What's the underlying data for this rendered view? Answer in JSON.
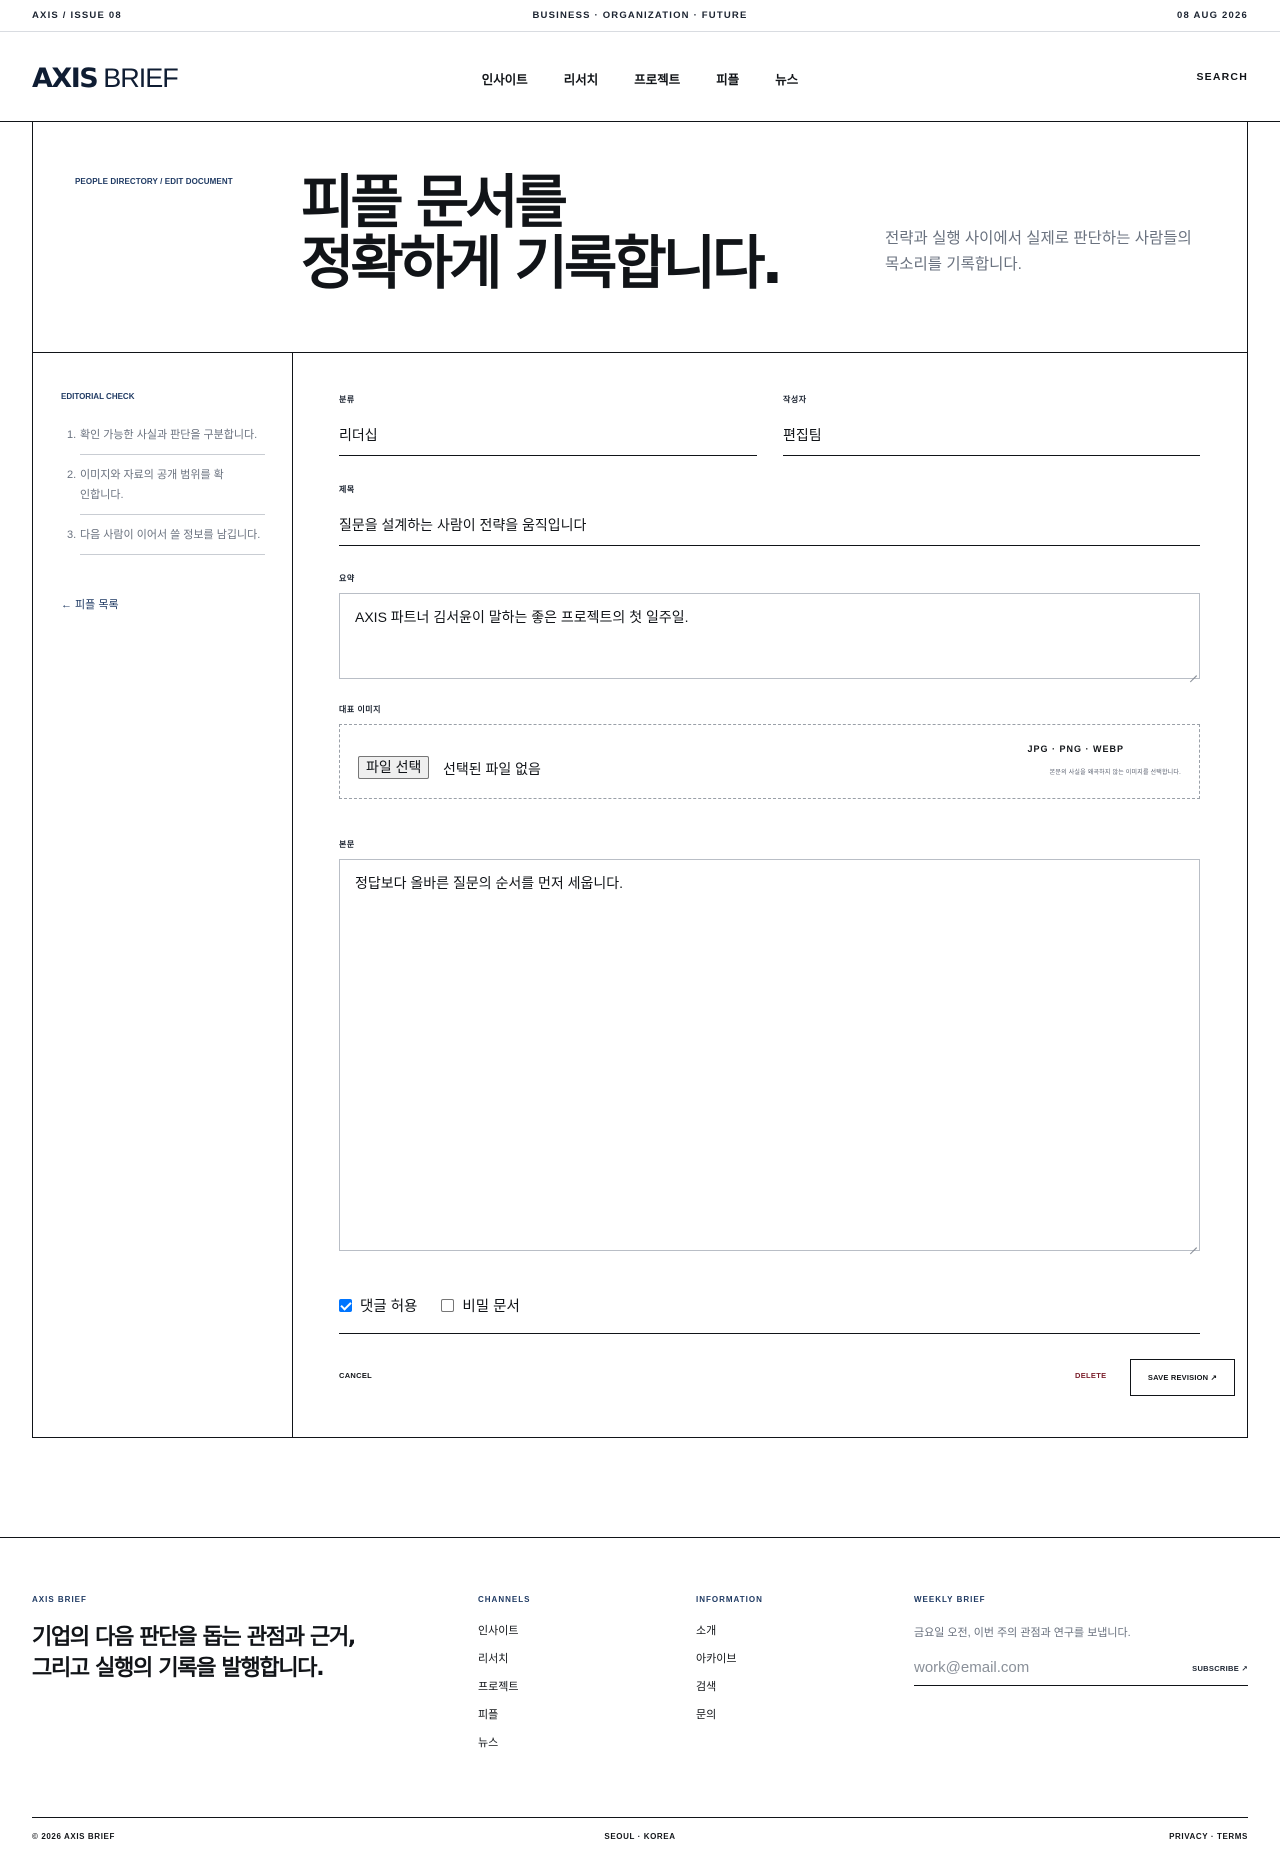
{
  "topbar": {
    "left": "AXIS / ISSUE 08",
    "center": "BUSINESS · ORGANIZATION · FUTURE",
    "right": "08 AUG 2026"
  },
  "header": {
    "logo_bold": "AXIS",
    "logo_light": "BRIEF",
    "nav": [
      "인사이트",
      "리서치",
      "프로젝트",
      "피플",
      "뉴스"
    ],
    "search": "SEARCH"
  },
  "hero": {
    "breadcrumb": "PEOPLE DIRECTORY / EDIT DOCUMENT",
    "title_line1": "피플 문서를",
    "title_line2": "정확하게 기록합니다.",
    "description": "전략과 실행 사이에서 실제로 판단하는 사람들의 목소리를 기록합니다."
  },
  "sidebar": {
    "label": "EDITORIAL CHECK",
    "checks": [
      {
        "num": "1.",
        "text": "확인 가능한 사실과 판단을 구분합니다."
      },
      {
        "num": "2.",
        "text": "이미지와 자료의 공개 범위를 확인합니다."
      },
      {
        "num": "3.",
        "text": "다음 사람이 이어서 쓸 정보를 남깁니다."
      }
    ],
    "back_link": "← 피플 목록"
  },
  "form": {
    "category_label": "분류",
    "category_value": "리더십",
    "author_label": "작성자",
    "author_value": "편집팀",
    "title_label": "제목",
    "title_value": "질문을 설계하는 사람이 전략을 움직입니다",
    "summary_label": "요약",
    "summary_value": "AXIS 파트너 김서윤이 말하는 좋은 프로젝트의 첫 일주일.",
    "image_label": "대표 이미지",
    "file_button": "파일 선택",
    "file_status": "선택된 파일 없음",
    "file_formats": "JPG · PNG · WEBP",
    "file_hint": "본문의 사실을 왜곡하지 않는 이미지를 선택합니다.",
    "body_label": "본문",
    "body_value": "정답보다 올바른 질문의 순서를 먼저 세웁니다.",
    "allow_comments_label": "댓글 허용",
    "allow_comments": true,
    "private_label": "비밀 문서",
    "private": false,
    "cancel": "CANCEL",
    "delete": "DELETE",
    "save": "SAVE REVISION ↗"
  },
  "footer": {
    "brand_label": "AXIS BRIEF",
    "tagline_line1": "기업의 다음 판단을 돕는 관점과 근거,",
    "tagline_line2": "그리고 실행의 기록을 발행합니다.",
    "channels_label": "CHANNELS",
    "channels": [
      "인사이트",
      "리서치",
      "프로젝트",
      "피플",
      "뉴스"
    ],
    "information_label": "INFORMATION",
    "information": [
      "소개",
      "아카이브",
      "검색",
      "문의"
    ],
    "weekly_label": "WEEKLY BRIEF",
    "weekly_desc": "금요일 오전, 이번 주의 관점과 연구를 보냅니다.",
    "email_placeholder": "work@email.com",
    "subscribe": "SUBSCRIBE ↗",
    "copyright": "© 2026 AXIS BRIEF",
    "location": "SEOUL · KOREA",
    "legal": "PRIVACY · TERMS"
  }
}
